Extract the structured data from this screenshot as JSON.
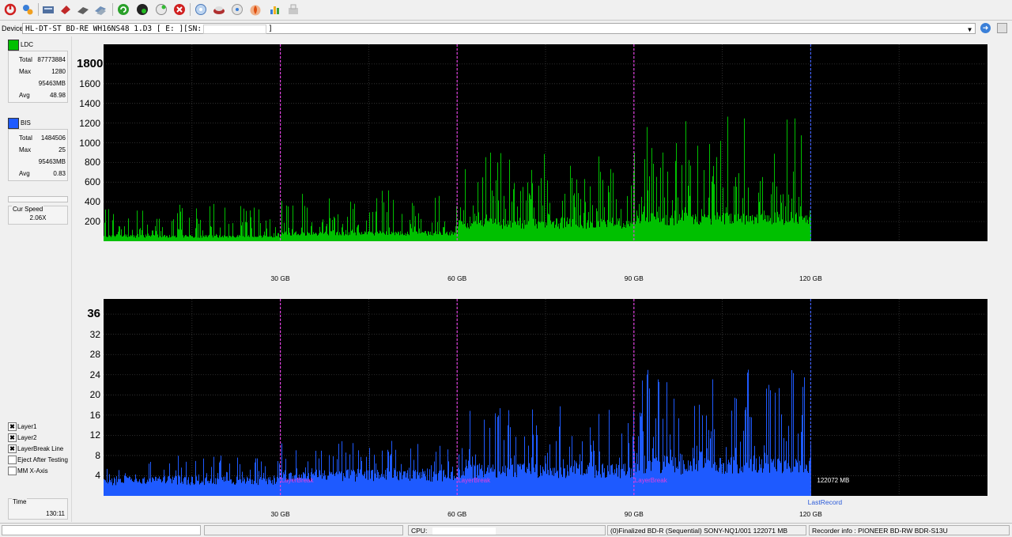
{
  "toolbar": {
    "buttons": [
      "power-icon",
      "options-icon",
      "drive-info-icon",
      "erase-icon",
      "disc-icon",
      "disc-copy-icon",
      "refresh-icon",
      "start-icon",
      "eject-icon",
      "stop-icon",
      "scan-icon",
      "burn-icon",
      "verify-icon",
      "flame-icon",
      "chart-icon",
      "save-icon"
    ]
  },
  "device": {
    "label": "Device:",
    "value": "HL-DT-ST BD-RE  WH16NS48  1.D3 [ E: ][SN:",
    "value_end": "]"
  },
  "ldc": {
    "name": "LDC",
    "color": "#00c000",
    "total_label": "Total",
    "total": "87773884",
    "max_label": "Max",
    "max": "1280",
    "mb": "95463MB",
    "avg_label": "Avg",
    "avg": "48.98"
  },
  "bis": {
    "name": "BIS",
    "color": "#0040ff",
    "total_label": "Total",
    "total": "1484506",
    "max_label": "Max",
    "max": "25",
    "mb": "95463MB",
    "avg_label": "Avg",
    "avg": "0.83"
  },
  "speed": {
    "label": "Cur Speed",
    "value": "2.06X"
  },
  "options": [
    {
      "label": "Layer1",
      "checked": true
    },
    {
      "label": "Layer2",
      "checked": true
    },
    {
      "label": "LayerBreak Line",
      "checked": true
    },
    {
      "label": "Eject After Testing",
      "checked": false
    },
    {
      "label": "MM X-Axis",
      "checked": false
    }
  ],
  "time": {
    "label": "Time",
    "value": "130:11"
  },
  "chart_data": [
    {
      "type": "bar",
      "series": [
        {
          "name": "LDC",
          "color": "#00c000"
        }
      ],
      "y_ticks": [
        "200",
        "400",
        "600",
        "800",
        "1000",
        "1200",
        "1400",
        "1600",
        "1800"
      ],
      "ylim": [
        0,
        2000
      ],
      "x_ticks": [
        "30 GB",
        "60 GB",
        "90 GB",
        "120 GB"
      ],
      "xlim_gb": [
        0,
        150
      ],
      "layer_breaks_gb": [
        30,
        60,
        90
      ],
      "data_end_gb": 120,
      "profile": [
        [
          0,
          50,
          380
        ],
        [
          30,
          80,
          520
        ],
        [
          60,
          180,
          900
        ],
        [
          90,
          230,
          1280
        ],
        [
          120,
          0,
          0
        ]
      ]
    },
    {
      "type": "bar",
      "series": [
        {
          "name": "BIS",
          "color": "#1e5aff"
        }
      ],
      "y_ticks": [
        "4",
        "8",
        "12",
        "16",
        "20",
        "24",
        "28",
        "32",
        "36"
      ],
      "ylim": [
        0,
        39
      ],
      "x_ticks": [
        "30 GB",
        "60 GB",
        "90 GB",
        "120 GB"
      ],
      "xlim_gb": [
        0,
        150
      ],
      "layer_breaks_gb": [
        30,
        60,
        90
      ],
      "layer_break_label": "LayerBreak",
      "data_end_gb": 120,
      "end_mb_label": "122072 MB",
      "last_record_label": "LastRecord",
      "profile": [
        [
          0,
          3,
          8
        ],
        [
          30,
          4,
          11
        ],
        [
          60,
          5,
          18
        ],
        [
          90,
          6,
          25
        ],
        [
          120,
          0,
          0
        ]
      ]
    }
  ],
  "status": {
    "cpu_label": "CPU:",
    "disc": "(0)Finalized  BD-R (Sequential)  SONY-NQ1/001   122071 MB",
    "recorder": "Recorder info : PIONEER      BD-RW   BDR-S13U"
  }
}
